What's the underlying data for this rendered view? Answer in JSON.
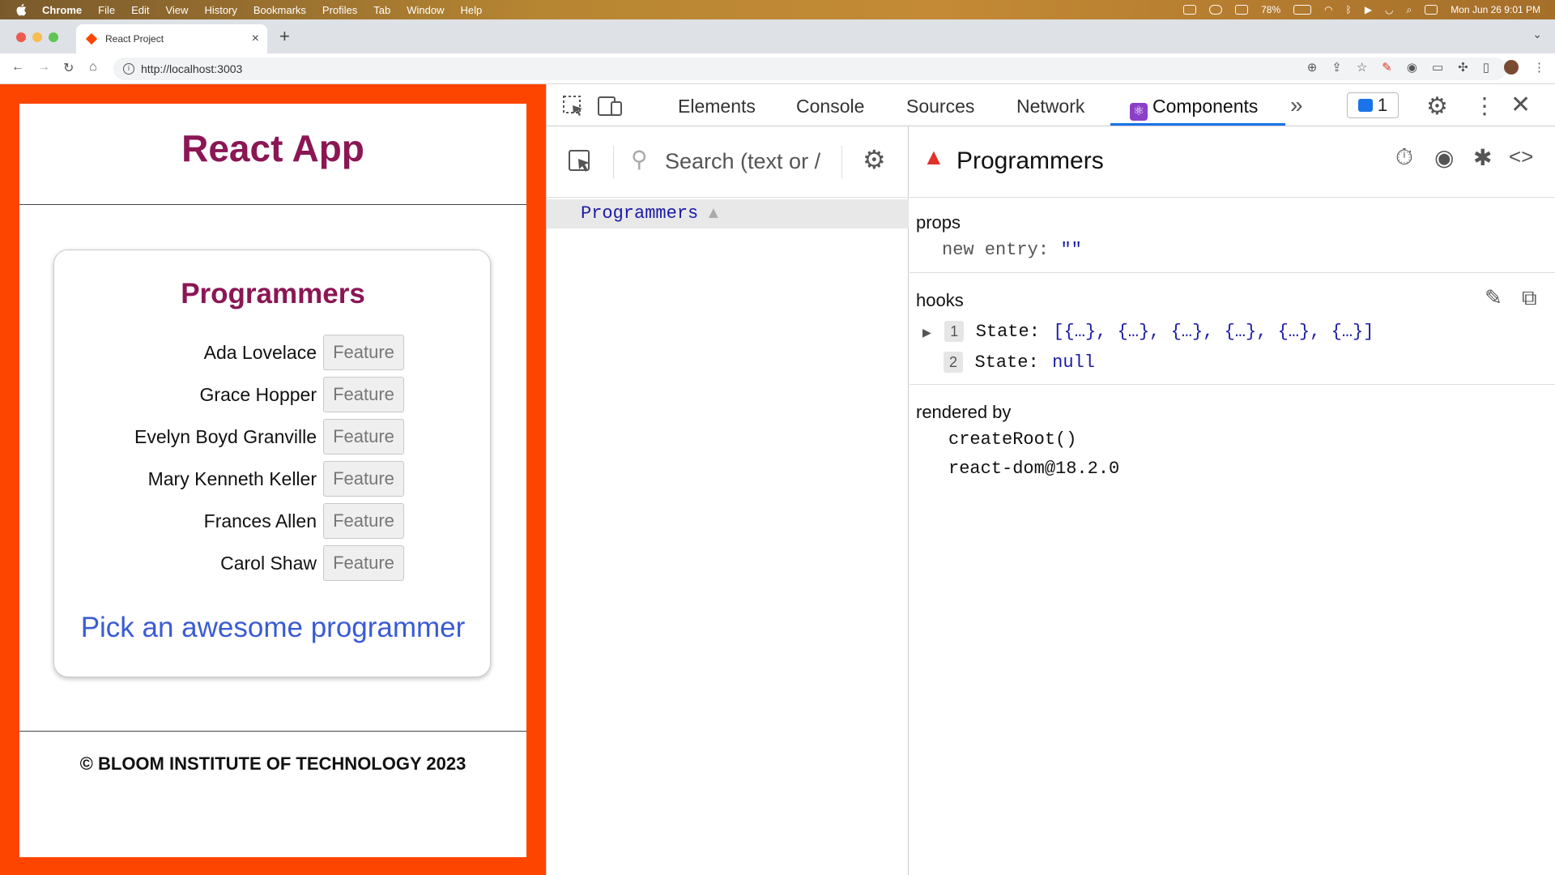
{
  "menubar": {
    "app": "Chrome",
    "items": [
      "File",
      "Edit",
      "View",
      "History",
      "Bookmarks",
      "Profiles",
      "Tab",
      "Window",
      "Help"
    ],
    "battery": "78%",
    "datetime": "Mon Jun 26  9:01 PM"
  },
  "browser": {
    "tab_title": "React Project",
    "url": "http://localhost:3003"
  },
  "app": {
    "title": "React App",
    "card_title": "Programmers",
    "feature_label": "Feature",
    "programmers": [
      "Ada Lovelace",
      "Grace Hopper",
      "Evelyn Boyd Granville",
      "Mary Kenneth Keller",
      "Frances Allen",
      "Carol Shaw"
    ],
    "pick_text": "Pick an awesome programmer",
    "footer": "© BLOOM INSTITUTE OF TECHNOLOGY 2023",
    "accent_color": "#fe4500"
  },
  "devtools": {
    "tabs": [
      "Elements",
      "Console",
      "Sources",
      "Network",
      "Components"
    ],
    "active_tab": "Components",
    "issues_count": "1",
    "search_placeholder": "Search (text or /",
    "tree_item": "Programmers",
    "selected_component": "Programmers",
    "props_label": "props",
    "prop_key": "new entry:",
    "prop_value": "\"\"",
    "hooks_label": "hooks",
    "hooks": [
      {
        "num": "1",
        "key": "State:",
        "value": "[{…}, {…}, {…}, {…}, {…}, {…}]"
      },
      {
        "num": "2",
        "key": "State:",
        "value": "null"
      }
    ],
    "rendered_by_label": "rendered by",
    "rendered_by": [
      "createRoot()",
      "react-dom@18.2.0"
    ]
  }
}
